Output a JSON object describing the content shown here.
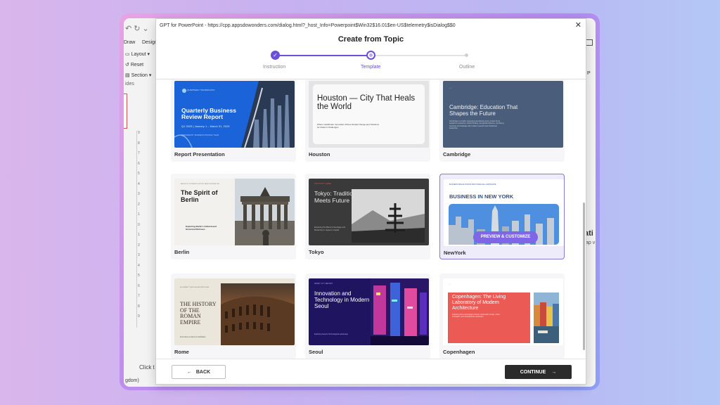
{
  "powerpoint": {
    "quick_access_icons": "↶ ↻ ⌄",
    "tabs": [
      "Draw",
      "Design"
    ],
    "ribbon_items": [
      "Layout",
      "Reset",
      "Section"
    ],
    "group_label": "ides",
    "ruler_numbers": [
      "9",
      "8",
      "7",
      "6",
      "5",
      "4",
      "3",
      "2",
      "1",
      "0",
      "1",
      "2",
      "3",
      "4",
      "5",
      "6",
      "7",
      "8",
      "9"
    ],
    "bottom_text": "Click t",
    "status_text": "gdom)",
    "right_partial_title": "ati",
    "right_partial_sub": "ap v",
    "right_p": "P"
  },
  "dialog": {
    "window_title": "GPT for PowerPoint - https://cpp.appsdowonders.com/dialog.html?_host_Info=Powerpoint$Win32$16.01$en-US$telemetry$isDialog$$0",
    "heading": "Create from Topic",
    "steps": [
      {
        "label": "Instruction",
        "status": "done"
      },
      {
        "label": "Template",
        "status": "current"
      },
      {
        "label": "Outline",
        "status": "todo"
      }
    ],
    "back_label": "BACK",
    "continue_label": "CONTINUE"
  },
  "templates": [
    {
      "name": "Report Presentation",
      "title": "Quarterly Business Review Report",
      "brand": "QUARTERLY TECHNOLOGY",
      "subtitle": "Q1 2025 | January 1 – March 31, 2025",
      "footnote": "PREPARED BY: BUSINESS STRATEGY TEAM"
    },
    {
      "name": "Houston",
      "title": "Houston — City That Heals the World",
      "subtitle": "Where Healthcare Innovation Drives Global Change and Solutions for Modern Challenges"
    },
    {
      "name": "Cambridge",
      "title": "Cambridge: Education That Shapes the Future",
      "subtitle": "Cambridge is a highly respected educational center, known for its academic excellence, critical thinking, and global influence, combining centuries of knowledge with modern research and intellectual leadership."
    },
    {
      "name": "Berlin",
      "title": "The Spirit of Berlin",
      "topline": "BERLIN OF CONTRASTS: HISTORY MEETS MODERN LIFE",
      "subtitle": "Exploring Berlin's Cultural and Historical Richness"
    },
    {
      "name": "Tokyo",
      "title": "Tokyo: Tradition Meets Future",
      "topline": "TOKYO CITY GUIDE",
      "subtitle": "Exploring the Blend of Heritage and Modernity in Japan's Capital"
    },
    {
      "name": "NewYork",
      "title": "BUSINESS IN NEW YORK",
      "topline": "BUSINESS REGULATIONS AND FINANCIAL LANDSCAPE",
      "overlay_button": "PREVIEW & CUSTOMIZE"
    },
    {
      "name": "Rome",
      "title": "THE HISTORY OF THE ROMAN EMPIRE",
      "topline": "A JOURNEY THROUGH ANCIENT ROME",
      "subtitle": "From Rise to Fall of a Civilization"
    },
    {
      "name": "Seoul",
      "title": "Innovation and Technology in Modern Seoul",
      "topline": "SMART CITY REPORT",
      "subtitle": "Exploring Seoul's Technological Landscape"
    },
    {
      "name": "Copenhagen",
      "title": "Copenhagen: The Living Laboratory of Modern Architecture",
      "subtitle": "Exploring how Copenhagen blends sustainable design, urban innovation, and Scandinavian aesthetics"
    }
  ],
  "colors": {
    "accent": "#6b4fd8",
    "report_blue": "#1a63d8",
    "cambridge_slate": "#4a5d7a",
    "copenhagen_coral": "#ec5a55",
    "continue_button": "#2b2b2b"
  }
}
